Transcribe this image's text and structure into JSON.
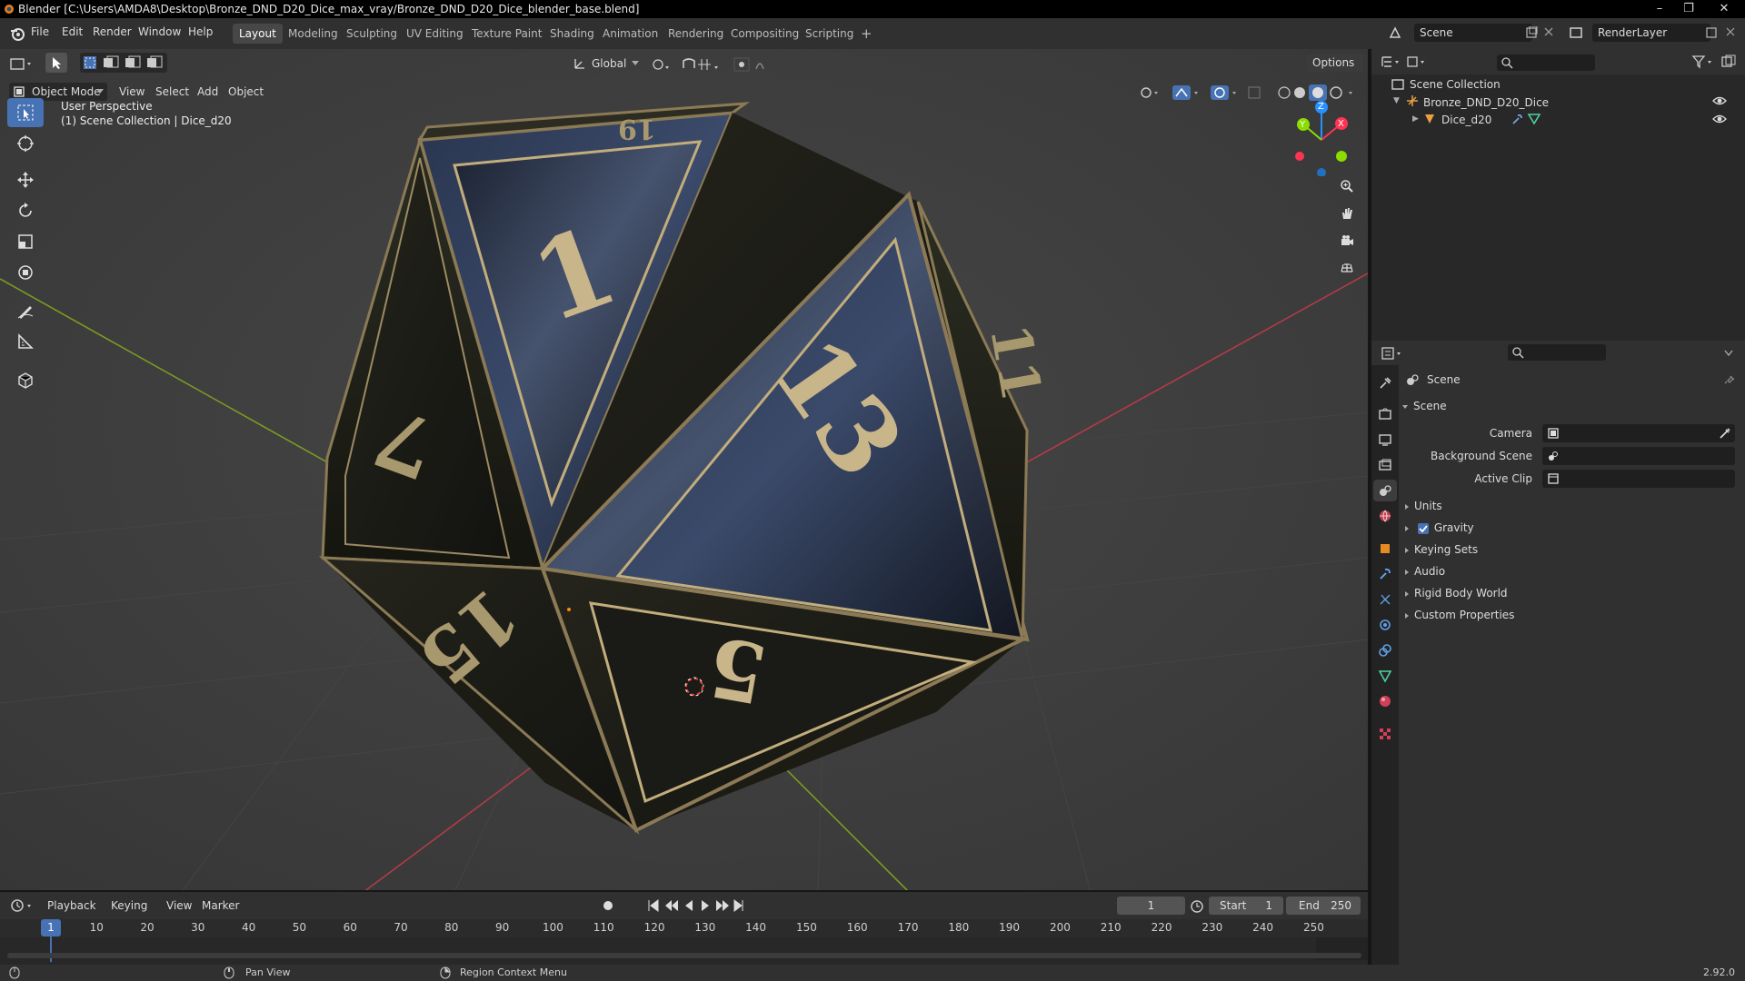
{
  "window": {
    "title": "Blender [C:\\Users\\AMDA8\\Desktop\\Bronze_DND_D20_Dice_max_vray/Bronze_DND_D20_Dice_blender_base.blend]"
  },
  "menu": {
    "items": [
      "File",
      "Edit",
      "Render",
      "Window",
      "Help"
    ]
  },
  "workspaces": {
    "tabs": [
      "Layout",
      "Modeling",
      "Sculpting",
      "UV Editing",
      "Texture Paint",
      "Shading",
      "Animation",
      "Rendering",
      "Compositing",
      "Scripting"
    ],
    "active": "Layout",
    "add_label": "+"
  },
  "scene_selector": {
    "scene": "Scene",
    "layer": "RenderLayer"
  },
  "viewport_header": {
    "mode": "Object Mode",
    "menus": [
      "View",
      "Select",
      "Add",
      "Object"
    ],
    "transform_orientation": "Global",
    "options_label": "Options"
  },
  "viewport": {
    "perspective": "User Perspective",
    "collection_info": "(1) Scene Collection | Dice_d20",
    "gizmo": {
      "x": "X",
      "y": "Y",
      "z": "Z"
    },
    "dice_numbers": [
      "1",
      "13",
      "5",
      "15",
      "7",
      "19",
      "11"
    ]
  },
  "toolbar": {
    "tools": [
      "select-box",
      "cursor",
      "move",
      "rotate",
      "scale",
      "transform",
      "annotate",
      "measure",
      "add-cube"
    ]
  },
  "timeline": {
    "menus": [
      "Playback",
      "Keying",
      "View",
      "Marker"
    ],
    "current_frame": "1",
    "start_label": "Start",
    "start": "1",
    "end_label": "End",
    "end": "250",
    "ruler": [
      "1",
      "10",
      "20",
      "30",
      "40",
      "50",
      "60",
      "70",
      "80",
      "90",
      "100",
      "110",
      "120",
      "130",
      "140",
      "150",
      "160",
      "170",
      "180",
      "190",
      "200",
      "210",
      "220",
      "230",
      "240",
      "250"
    ]
  },
  "status_bar": {
    "pan_view": "Pan View",
    "context_menu": "Region Context Menu",
    "version": "2.92.0"
  },
  "outliner": {
    "root": "Scene Collection",
    "items": [
      {
        "label": "Bronze_DND_D20_Dice",
        "depth": 1
      },
      {
        "label": "Dice_d20",
        "depth": 2
      }
    ]
  },
  "properties": {
    "context_label": "Scene",
    "panel_title": "Scene",
    "fields": [
      {
        "label": "Camera"
      },
      {
        "label": "Background Scene"
      },
      {
        "label": "Active Clip"
      }
    ],
    "subpanels": [
      "Units",
      "Gravity",
      "Keying Sets",
      "Audio",
      "Rigid Body World",
      "Custom Properties"
    ],
    "gravity_enabled": true
  },
  "colors": {
    "active_blue": "#4772b3",
    "axis_x": "#ff3352",
    "axis_y": "#8bdc00",
    "axis_z": "#2890ff",
    "bronze": "#c8b58a"
  }
}
